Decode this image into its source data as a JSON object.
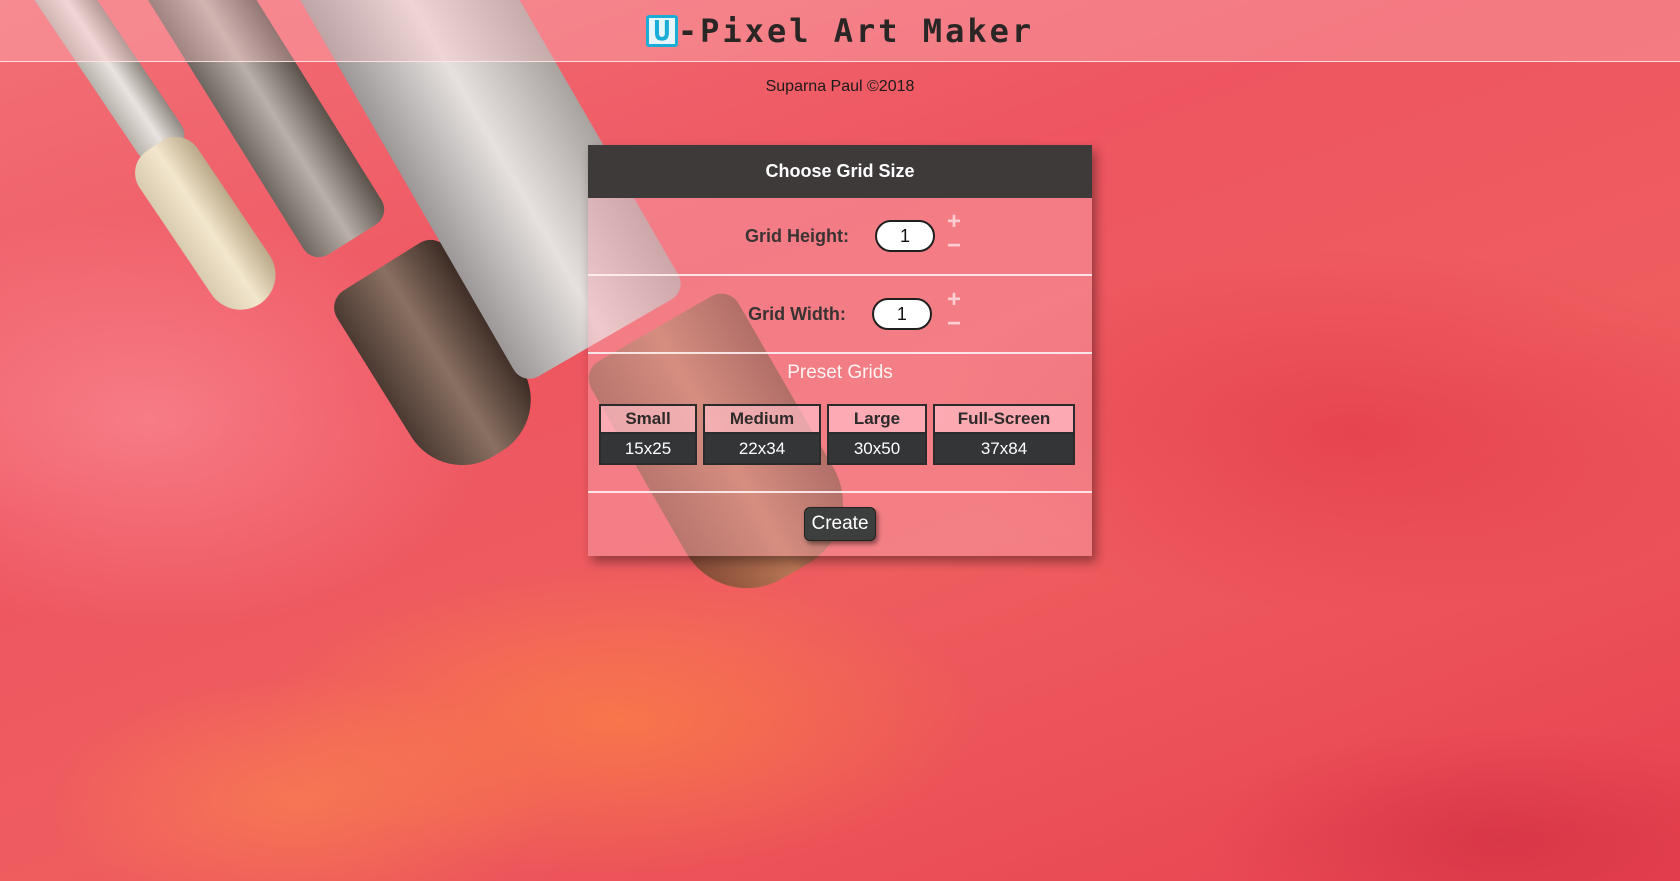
{
  "header": {
    "logo_letter": "U",
    "title": "-Pixel Art Maker"
  },
  "byline": "Suparna Paul ©2018",
  "panel": {
    "title": "Choose Grid Size",
    "height_label": "Grid Height:",
    "height_value": "1",
    "width_label": "Grid Width:",
    "width_value": "1",
    "stepper_plus": "+",
    "stepper_minus": "−",
    "preset_title": "Preset Grids",
    "presets": [
      {
        "name": "Small",
        "size": "15x25"
      },
      {
        "name": "Medium",
        "size": "22x34"
      },
      {
        "name": "Large",
        "size": "30x50"
      },
      {
        "name": "Full-Screen",
        "size": "37x84"
      }
    ],
    "create_label": "Create"
  },
  "colors": {
    "panel_header": "#3e3a3a",
    "logo_accent": "#1aaed6",
    "background": "#ef5d5f"
  }
}
